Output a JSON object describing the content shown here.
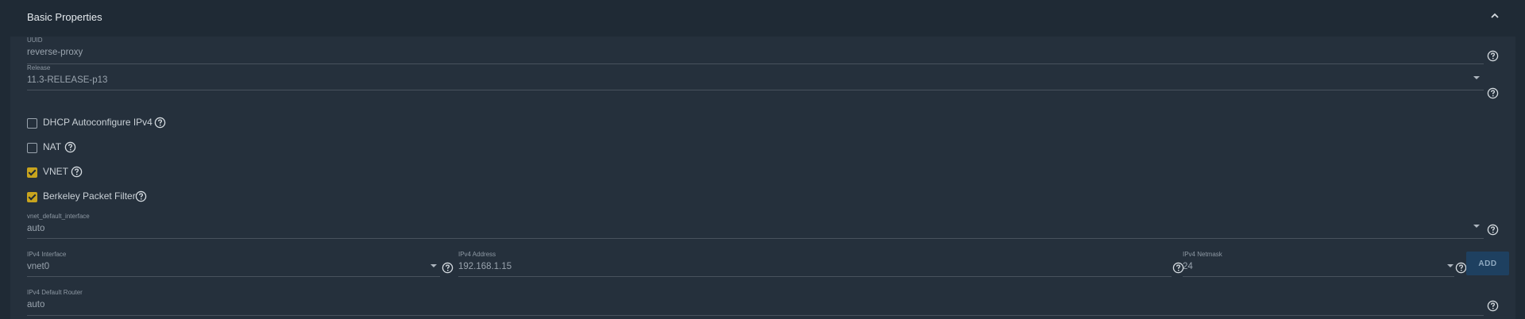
{
  "header": {
    "title": "Basic Properties",
    "collapse_icon": "chevron-up-icon"
  },
  "fields": {
    "uuid": {
      "label": "UUID",
      "value": "reverse-proxy"
    },
    "release": {
      "label": "Release",
      "value": "11.3-RELEASE-p13"
    },
    "vnet_default_interface": {
      "label": "vnet_default_interface",
      "value": "auto"
    },
    "ipv4_interface": {
      "label": "IPv4 Interface",
      "value": "vnet0"
    },
    "ipv4_address": {
      "label": "IPv4 Address",
      "value": "192.168.1.15"
    },
    "ipv4_netmask": {
      "label": "IPv4 Netmask",
      "value": "24"
    },
    "ipv4_default_router": {
      "label": "IPv4 Default Router",
      "value": "auto"
    }
  },
  "checkboxes": [
    {
      "label": "DHCP Autoconfigure IPv4",
      "checked": false
    },
    {
      "label": "NAT",
      "checked": false
    },
    {
      "label": "VNET",
      "checked": true
    },
    {
      "label": "Berkeley Packet Filter",
      "checked": true
    }
  ],
  "buttons": {
    "add_label": "ADD"
  },
  "colors": {
    "background": "#1f2a35",
    "panel": "#25303c",
    "accent_checkbox": "#c8a41e",
    "add_button": "#1e4060"
  }
}
